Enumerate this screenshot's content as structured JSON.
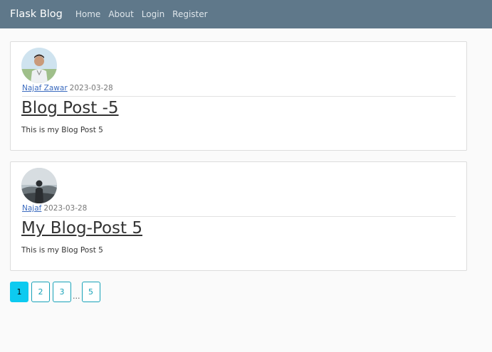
{
  "navbar": {
    "brand": "Flask Blog",
    "links": [
      "Home",
      "About",
      "Login",
      "Register"
    ]
  },
  "posts": [
    {
      "author": "Najaf Zawar",
      "date": "2023-03-28",
      "title": "Blog Post -5",
      "content": "This is my Blog Post 5"
    },
    {
      "author": "Najaf",
      "date": "2023-03-28",
      "title": "My Blog-Post 5",
      "content": "This is my Blog Post 5"
    }
  ],
  "pagination": {
    "pages": [
      "1",
      "2",
      "3",
      "5"
    ],
    "ellipsis": "...",
    "active": "1"
  },
  "colors": {
    "navbar": "#5f788a",
    "page_active": "#0dcaf0",
    "page_border": "#17a2b8",
    "link": "#3b6bbf"
  }
}
